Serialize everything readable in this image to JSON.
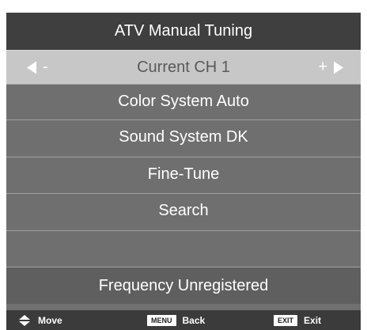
{
  "menu": {
    "title": "ATV Manual Tuning",
    "items": [
      {
        "label": "Current CH 1",
        "left_symbol": "-",
        "right_symbol": "+"
      },
      {
        "label": "Color System Auto"
      },
      {
        "label": "Sound System DK"
      },
      {
        "label": "Fine-Tune"
      },
      {
        "label": "Search"
      },
      {
        "label": ""
      }
    ],
    "status": "Frequency Unregistered"
  },
  "footer": {
    "move": {
      "label": "Move",
      "icon": "up-down-arrows-icon"
    },
    "back": {
      "key": "MENU",
      "label": "Back"
    },
    "exit": {
      "key": "EXIT",
      "label": "Exit"
    }
  },
  "colors": {
    "title_bg": "#3f3f3f",
    "row_bg": "#6f6f6f",
    "selected_bg": "#c7c7c7",
    "footer_bg": "#3b3b3b"
  }
}
